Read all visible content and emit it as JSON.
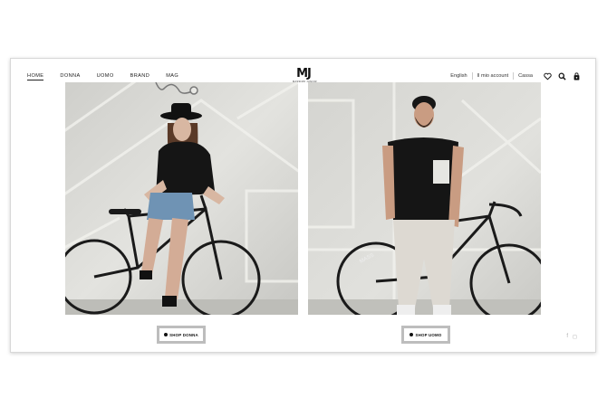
{
  "nav": {
    "items": [
      "HOME",
      "DONNA",
      "UOMO",
      "BRAND",
      "MAG"
    ],
    "active": "HOME"
  },
  "logo": {
    "mark": "MJ",
    "sub": "MASSIMO JUNIOR"
  },
  "utility": {
    "language": "English",
    "account": "Il mio account",
    "cart": "Cassa",
    "icons": [
      "heart-icon",
      "search-icon",
      "bag-icon"
    ]
  },
  "banners": {
    "left_button": "SHOP DONNA",
    "right_button": "SHOP UOMO"
  },
  "social": {
    "facebook": "f",
    "instagram": "◻"
  },
  "colors": {
    "accent": "#111111",
    "button_border": "#bdbdbd",
    "photo_wall": "#d9d9d6"
  }
}
